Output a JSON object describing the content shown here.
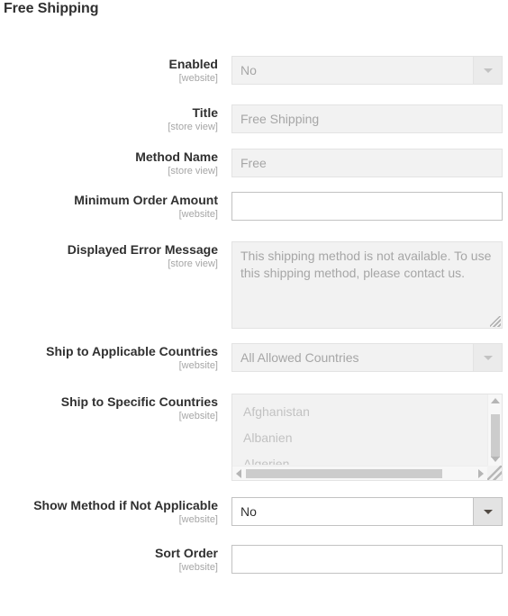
{
  "page": {
    "title": "Free Shipping"
  },
  "scopes": {
    "website": "[website]",
    "store_view": "[store view]"
  },
  "fields": {
    "enabled": {
      "label": "Enabled",
      "scope": "[website]",
      "value": "No",
      "icon": "chevron-down-icon"
    },
    "title": {
      "label": "Title",
      "scope": "[store view]",
      "value": "Free Shipping"
    },
    "method_name": {
      "label": "Method Name",
      "scope": "[store view]",
      "value": "Free"
    },
    "minimum_order_amount": {
      "label": "Minimum Order Amount",
      "scope": "[website]",
      "value": ""
    },
    "displayed_error_message": {
      "label": "Displayed Error Message",
      "scope": "[store view]",
      "value": "This shipping method is not available. To use this shipping method, please contact us."
    },
    "ship_to_applicable_countries": {
      "label": "Ship to Applicable Countries",
      "scope": "[website]",
      "value": "All Allowed Countries",
      "icon": "chevron-down-icon"
    },
    "ship_to_specific_countries": {
      "label": "Ship to Specific Countries",
      "scope": "[website]",
      "options": [
        "Afghanistan",
        "Albanien",
        "Algerien"
      ]
    },
    "show_method_if_not_applicable": {
      "label": "Show Method if Not Applicable",
      "scope": "[website]",
      "value": "No",
      "icon": "chevron-down-icon"
    },
    "sort_order": {
      "label": "Sort Order",
      "scope": "[website]",
      "value": ""
    }
  },
  "colors": {
    "text": "#303030",
    "muted": "#a6a6a6",
    "border": "#c2c2c2",
    "disabled_bg": "#f2f2f2",
    "disabled_border": "#e3e3e3"
  }
}
